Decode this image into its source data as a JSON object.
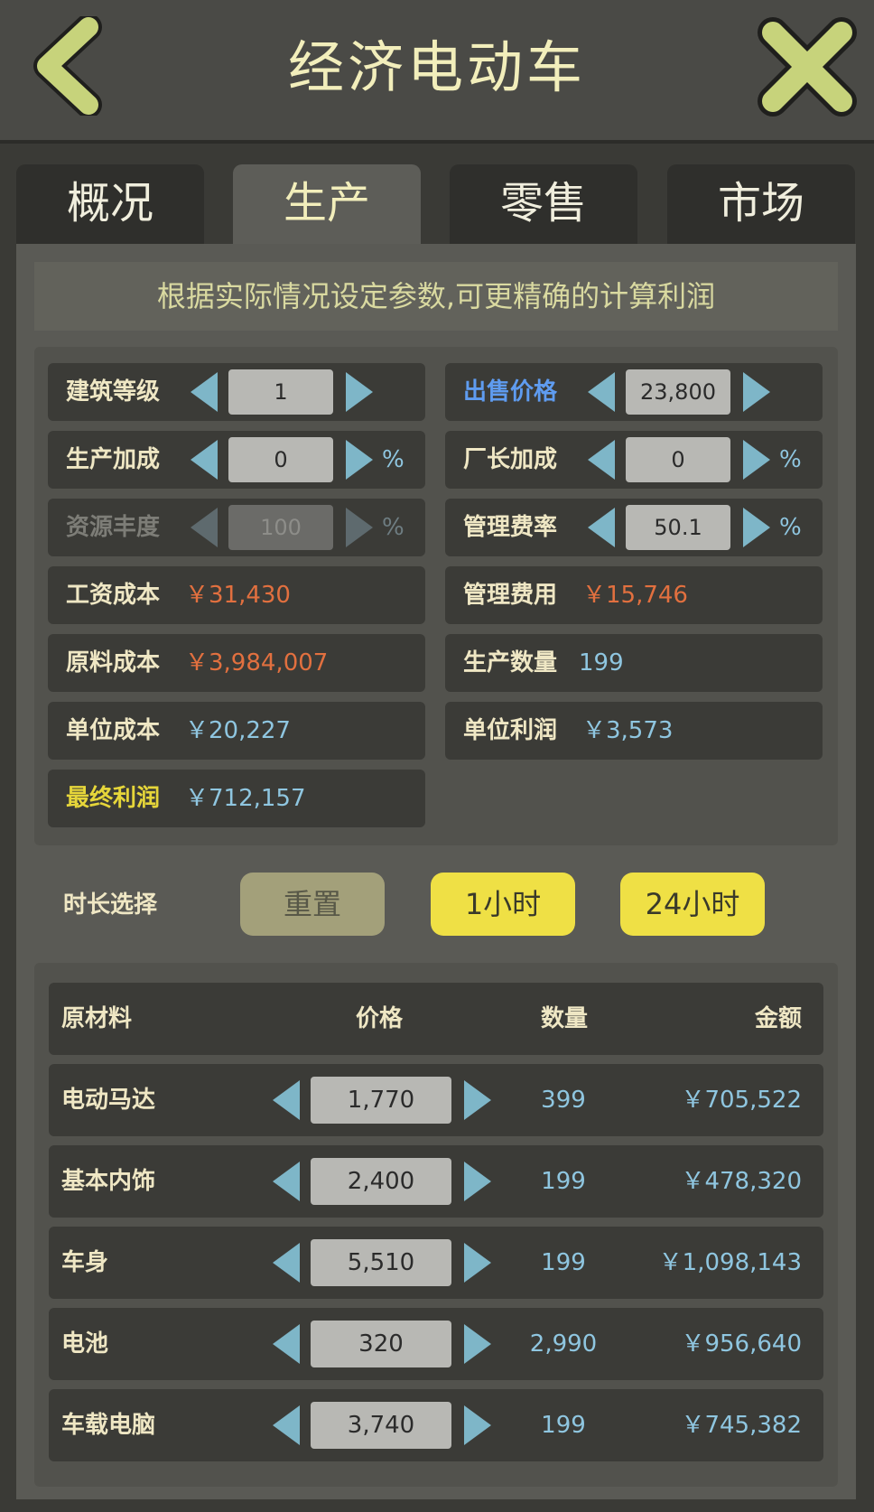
{
  "header": {
    "title": "经济电动车",
    "back_icon": "chevron-left-icon",
    "close_icon": "close-x-icon",
    "icon_color": "#c7d37b"
  },
  "tabs": [
    {
      "label": "概况",
      "active": false
    },
    {
      "label": "生产",
      "active": true
    },
    {
      "label": "零售",
      "active": false
    },
    {
      "label": "市场",
      "active": false
    }
  ],
  "hint": "根据实际情况设定参数,可更精确的计算利润",
  "params": {
    "building_level": {
      "label": "建筑等级",
      "value": "1"
    },
    "sale_price": {
      "label": "出售价格",
      "value": "23,800"
    },
    "production_bonus": {
      "label": "生产加成",
      "value": "0",
      "unit": "%"
    },
    "director_bonus": {
      "label": "厂长加成",
      "value": "0",
      "unit": "%"
    },
    "resource_abundance": {
      "label": "资源丰度",
      "value": "100",
      "unit": "%"
    },
    "admin_rate": {
      "label": "管理费率",
      "value": "50.1",
      "unit": "%"
    },
    "wage_cost": {
      "label": "工资成本",
      "value": "￥31,430"
    },
    "admin_cost": {
      "label": "管理费用",
      "value": "￥15,746"
    },
    "material_cost": {
      "label": "原料成本",
      "value": "￥3,984,007"
    },
    "production_qty": {
      "label": "生产数量",
      "value": "199"
    },
    "unit_cost": {
      "label": "单位成本",
      "value": "￥20,227"
    },
    "unit_profit": {
      "label": "单位利润",
      "value": "￥3,573"
    },
    "final_profit": {
      "label": "最终利润",
      "value": "￥712,157"
    }
  },
  "duration": {
    "label": "时长选择",
    "reset": "重置",
    "one_hour": "1小时",
    "day": "24小时"
  },
  "materials": {
    "headers": {
      "name": "原材料",
      "price": "价格",
      "qty": "数量",
      "amount": "金额"
    },
    "rows": [
      {
        "name": "电动马达",
        "price": "1,770",
        "qty": "399",
        "amount": "￥705,522"
      },
      {
        "name": "基本内饰",
        "price": "2,400",
        "qty": "199",
        "amount": "￥478,320"
      },
      {
        "name": "车身",
        "price": "5,510",
        "qty": "199",
        "amount": "￥1,098,143"
      },
      {
        "name": "电池",
        "price": "320",
        "qty": "2,990",
        "amount": "￥956,640"
      },
      {
        "name": "车载电脑",
        "price": "3,740",
        "qty": "199",
        "amount": "￥745,382"
      }
    ]
  }
}
